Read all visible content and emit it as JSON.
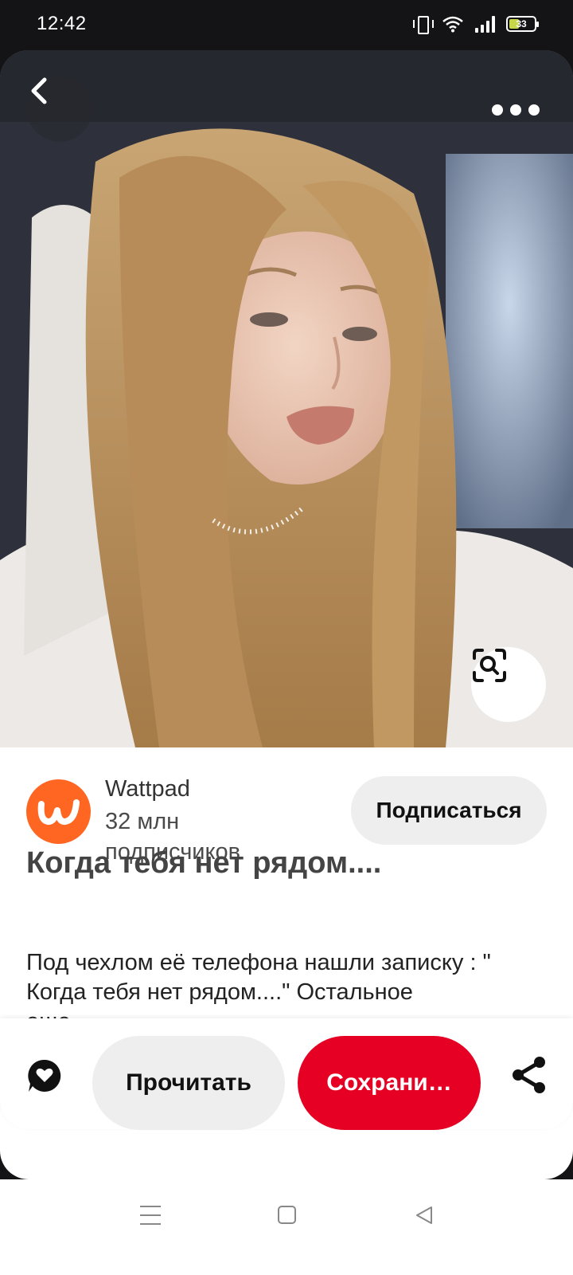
{
  "status_bar": {
    "time": "12:42",
    "battery_level": "33",
    "icons": [
      "vibrate-icon",
      "wifi-icon",
      "signal-icon",
      "battery-icon"
    ]
  },
  "pin": {
    "image_description_icon": "photo",
    "top_controls": {
      "back_icon": "chevron-left-icon",
      "more_icon": "more-dots-icon",
      "visual_search_icon": "lens-search-icon"
    }
  },
  "creator": {
    "name": "Wattpad",
    "followers": "32 млн подписчиков",
    "follow_label": "Подписаться",
    "avatar_letter": "w",
    "avatar_color": "#ff6622"
  },
  "content": {
    "title": "Когда тебя нет рядом....",
    "description": "Под чехлом её телефона нашли записку : \" Когда тебя нет рядом....\" Остальное",
    "description_more": "еще"
  },
  "actions": {
    "read_label": "Прочитать",
    "save_label": "Сохрани…",
    "comment_icon": "comment-heart-icon",
    "share_icon": "share-icon",
    "save_color": "#e60023"
  },
  "nav_bar": {
    "icons": [
      "menu-icon",
      "home-icon",
      "back-triangle-icon"
    ]
  }
}
